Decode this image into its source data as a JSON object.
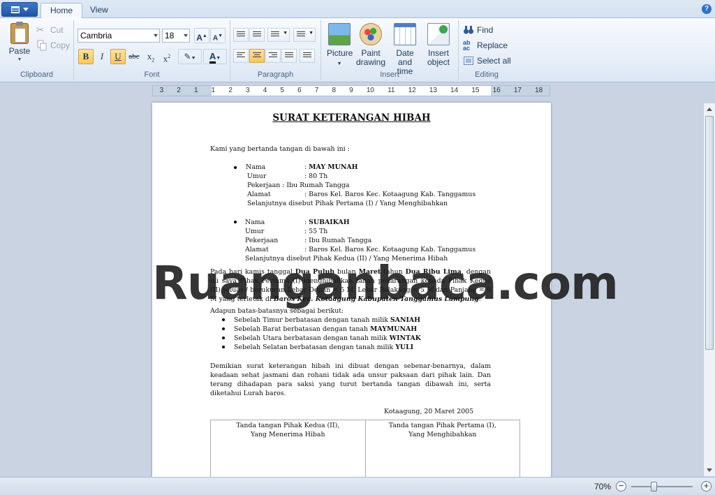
{
  "tabs": {
    "home": "Home",
    "view": "View"
  },
  "ribbon": {
    "clipboard": {
      "label": "Clipboard",
      "paste": "Paste",
      "cut": "Cut",
      "copy": "Copy"
    },
    "font": {
      "label": "Font",
      "family": "Cambria",
      "size": "18"
    },
    "paragraph": {
      "label": "Paragraph"
    },
    "insert": {
      "label": "Insert",
      "picture": "Picture",
      "paint_line1": "Paint",
      "paint_line2": "drawing",
      "date_line1": "Date and",
      "date_line2": "time",
      "object_line1": "Insert",
      "object_line2": "object"
    },
    "editing": {
      "label": "Editing",
      "find": "Find",
      "replace": "Replace",
      "select_all": "Select all"
    }
  },
  "ruler": [
    "3",
    "2",
    "1",
    "1",
    "2",
    "3",
    "4",
    "5",
    "6",
    "7",
    "8",
    "9",
    "10",
    "11",
    "12",
    "13",
    "14",
    "15",
    "16",
    "17",
    "18"
  ],
  "document": {
    "title": "SURAT KETERANGAN HIBAH",
    "intro": "Kami yang bertanda tangan di bawah ini :",
    "party1": {
      "nama_label": "Nama",
      "nama": "MAY MUNAH",
      "umur_label": "Umur",
      "umur": ": 80 Th",
      "pekerjaan": "Pekerjaan : Ibu Rumah Tangga",
      "alamat_label": "Alamat",
      "alamat": ": Baros Kel. Baros Kec. Kotaagung Kab. Tanggamus",
      "desc": "Selanjutnya disebut Pihak Pertama (I) / Yang Menghibahkan"
    },
    "party2": {
      "nama_label": "Nama",
      "nama": "SUBAIKAH",
      "umur_label": "Umur",
      "umur": ": 55 Th",
      "pekerjaan_label": "Pekerjaan",
      "pekerjaan": ": Ibu Rumah Tangga",
      "alamat_label": "Alamat",
      "alamat": ": Baros Kel. Baros Kec. Kotaagung Kab. Tanggamus",
      "desc": "Selanjutnya disebut Pihak Kedua (II) / Yang Menerima Hibah"
    },
    "para1": {
      "p1": "Pada hari kamis tanggal ",
      "p1b": "Dua Puluh",
      "p2": " bulan ",
      "p2b": "Maret",
      "p3": " tahun ",
      "p3b": "Dua Ribu Lima",
      "p4": ", dengan ini saya Pihak Pertama (I) menghibahkan tanah pekarangan kepada Pihak Kedua (II) seluas / berukuran Lebar Depan = 5 M, Lebar Belakang = 5 M dan Panjang = 9 M yang terletak di ",
      "p4b": "Baros Kec. Kotaagung Kabupaten Tanggamus Lampung",
      "p5": "."
    },
    "borders_intro": "Adapun batas-batasnya sebagai berikut:",
    "borders": [
      {
        "text": "Sebelah Timur berbatasan dengan  tanah milik ",
        "owner": "SANIAH"
      },
      {
        "text": "Sebelah  Barat berbatasan dengan  tanah ",
        "owner": "MAYMUNAH"
      },
      {
        "text": "Sebelah Utara  berbatasan dengan  tanah milik ",
        "owner": "WINTAK"
      },
      {
        "text": "Sebelah Selatan  berbatasan dengan  tanah milik ",
        "owner": "YULI"
      }
    ],
    "closing": "Demikian surat keterangan hibah ini dibuat dengan sebenar-benarnya, dalam keadaan sehat jasmani dan rohani tidak ada unsur paksaan dari pihak lain. Dan terang dihadapan para saksi yang turut bertanda tangan dibawah ini, serta diketahui Lurah baros.",
    "place_date": "Kotaagung, 20 Maret 2005",
    "sign_left_1": "Tanda tangan Pihak Kedua (II),",
    "sign_left_2": "Yang Menerima Hibah",
    "sign_right_1": "Tanda tangan Pihak Pertama (I),",
    "sign_right_2": "Yang Menghibahkan"
  },
  "watermark": "Ruanganbaca.com",
  "status": {
    "zoom": "70%"
  }
}
